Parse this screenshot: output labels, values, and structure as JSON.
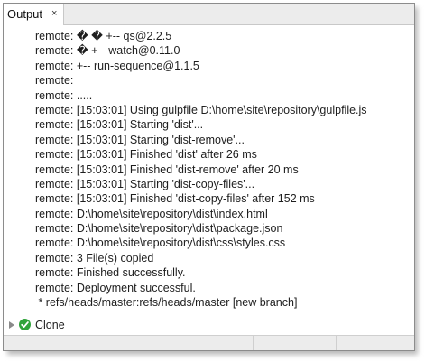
{
  "tab": {
    "title": "Output",
    "close_glyph": "×"
  },
  "output_lines": [
    "remote: � � +-- qs@2.2.5",
    "remote: � +-- watch@0.11.0",
    "remote: +-- run-sequence@1.1.5",
    "remote:",
    "remote: .....",
    "remote: [15:03:01] Using gulpfile D:\\home\\site\\repository\\gulpfile.js",
    "remote: [15:03:01] Starting 'dist'...",
    "remote: [15:03:01] Starting 'dist-remove'...",
    "remote: [15:03:01] Finished 'dist' after 26 ms",
    "remote: [15:03:01] Finished 'dist-remove' after 20 ms",
    "remote: [15:03:01] Starting 'dist-copy-files'...",
    "remote: [15:03:01] Finished 'dist-copy-files' after 152 ms",
    "remote: D:\\home\\site\\repository\\dist\\index.html",
    "remote: D:\\home\\site\\repository\\dist\\package.json",
    "remote: D:\\home\\site\\repository\\dist\\css\\styles.css",
    "remote: 3 File(s) copied",
    "remote: Finished successfully.",
    "remote: Deployment successful.",
    " * refs/heads/master:refs/heads/master [new branch]"
  ],
  "task": {
    "label": "Clone",
    "status_icon": "check-icon",
    "status_color": "#2fa33a"
  }
}
